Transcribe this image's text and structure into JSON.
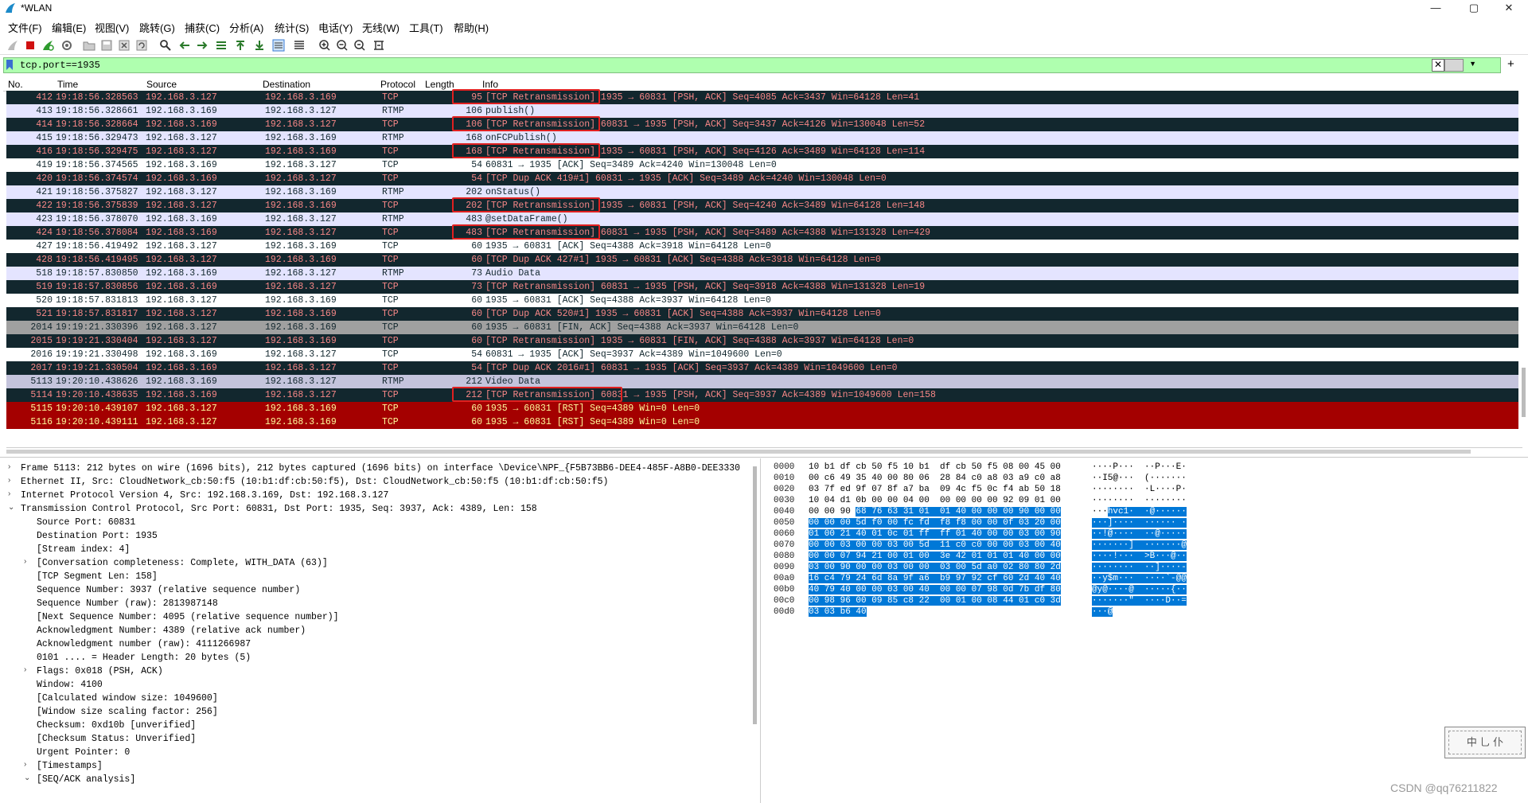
{
  "window": {
    "title": "*WLAN",
    "min": "—",
    "max": "▢",
    "close": "✕"
  },
  "menu": [
    "文件(F)",
    "编辑(E)",
    "视图(V)",
    "跳转(G)",
    "捕获(C)",
    "分析(A)",
    "统计(S)",
    "电话(Y)",
    "无线(W)",
    "工具(T)",
    "帮助(H)"
  ],
  "filter": {
    "value": "tcp.port==1935",
    "clear": "✕",
    "dropdown": "▼",
    "add": "+"
  },
  "columns": [
    "No.",
    "Time",
    "Source",
    "Destination",
    "Protocol",
    "Length",
    "Info"
  ],
  "packets": [
    {
      "no": "412",
      "time": "19:18:56.328563",
      "src": "192.168.3.127",
      "dst": "192.168.3.169",
      "proto": "TCP",
      "len": "95",
      "info": "[TCP Retransmission] 1935 → 60831 [PSH, ACK] Seq=4085 Ack=3437 Win=64128 Len=41",
      "style": "dark",
      "box": true
    },
    {
      "no": "413",
      "time": "19:18:56.328661",
      "src": "192.168.3.169",
      "dst": "192.168.3.127",
      "proto": "RTMP",
      "len": "106",
      "info": "publish()",
      "style": "light"
    },
    {
      "no": "414",
      "time": "19:18:56.328664",
      "src": "192.168.3.169",
      "dst": "192.168.3.127",
      "proto": "TCP",
      "len": "106",
      "info": "[TCP Retransmission] 60831 → 1935 [PSH, ACK] Seq=3437 Ack=4126 Win=130048 Len=52",
      "style": "dark",
      "box": true
    },
    {
      "no": "415",
      "time": "19:18:56.329473",
      "src": "192.168.3.127",
      "dst": "192.168.3.169",
      "proto": "RTMP",
      "len": "168",
      "info": "onFCPublish()",
      "style": "light"
    },
    {
      "no": "416",
      "time": "19:18:56.329475",
      "src": "192.168.3.127",
      "dst": "192.168.3.169",
      "proto": "TCP",
      "len": "168",
      "info": "[TCP Retransmission] 1935 → 60831 [PSH, ACK] Seq=4126 Ack=3489 Win=64128 Len=114",
      "style": "dark",
      "box": true
    },
    {
      "no": "419",
      "time": "19:18:56.374565",
      "src": "192.168.3.169",
      "dst": "192.168.3.127",
      "proto": "TCP",
      "len": "54",
      "info": "60831 → 1935 [ACK] Seq=3489 Ack=4240 Win=130048 Len=0",
      "style": "white"
    },
    {
      "no": "420",
      "time": "19:18:56.374574",
      "src": "192.168.3.169",
      "dst": "192.168.3.127",
      "proto": "TCP",
      "len": "54",
      "info": "[TCP Dup ACK 419#1] 60831 → 1935 [ACK] Seq=3489 Ack=4240 Win=130048 Len=0",
      "style": "dark"
    },
    {
      "no": "421",
      "time": "19:18:56.375827",
      "src": "192.168.3.127",
      "dst": "192.168.3.169",
      "proto": "RTMP",
      "len": "202",
      "info": "onStatus()",
      "style": "light"
    },
    {
      "no": "422",
      "time": "19:18:56.375839",
      "src": "192.168.3.127",
      "dst": "192.168.3.169",
      "proto": "TCP",
      "len": "202",
      "info": "[TCP Retransmission] 1935 → 60831 [PSH, ACK] Seq=4240 Ack=3489 Win=64128 Len=148",
      "style": "dark",
      "box": true
    },
    {
      "no": "423",
      "time": "19:18:56.378070",
      "src": "192.168.3.169",
      "dst": "192.168.3.127",
      "proto": "RTMP",
      "len": "483",
      "info": "@setDataFrame()",
      "style": "light"
    },
    {
      "no": "424",
      "time": "19:18:56.378084",
      "src": "192.168.3.169",
      "dst": "192.168.3.127",
      "proto": "TCP",
      "len": "483",
      "info": "[TCP Retransmission] 60831 → 1935 [PSH, ACK] Seq=3489 Ack=4388 Win=131328 Len=429",
      "style": "dark",
      "box": true
    },
    {
      "no": "427",
      "time": "19:18:56.419492",
      "src": "192.168.3.127",
      "dst": "192.168.3.169",
      "proto": "TCP",
      "len": "60",
      "info": "1935 → 60831 [ACK] Seq=4388 Ack=3918 Win=64128 Len=0",
      "style": "white"
    },
    {
      "no": "428",
      "time": "19:18:56.419495",
      "src": "192.168.3.127",
      "dst": "192.168.3.169",
      "proto": "TCP",
      "len": "60",
      "info": "[TCP Dup ACK 427#1] 1935 → 60831 [ACK] Seq=4388 Ack=3918 Win=64128 Len=0",
      "style": "dark"
    },
    {
      "no": "518",
      "time": "19:18:57.830850",
      "src": "192.168.3.169",
      "dst": "192.168.3.127",
      "proto": "RTMP",
      "len": "73",
      "info": "Audio Data",
      "style": "light"
    },
    {
      "no": "519",
      "time": "19:18:57.830856",
      "src": "192.168.3.169",
      "dst": "192.168.3.127",
      "proto": "TCP",
      "len": "73",
      "info": "[TCP Retransmission] 60831 → 1935 [PSH, ACK] Seq=3918 Ack=4388 Win=131328 Len=19",
      "style": "dark"
    },
    {
      "no": "520",
      "time": "19:18:57.831813",
      "src": "192.168.3.127",
      "dst": "192.168.3.169",
      "proto": "TCP",
      "len": "60",
      "info": "1935 → 60831 [ACK] Seq=4388 Ack=3937 Win=64128 Len=0",
      "style": "white"
    },
    {
      "no": "521",
      "time": "19:18:57.831817",
      "src": "192.168.3.127",
      "dst": "192.168.3.169",
      "proto": "TCP",
      "len": "60",
      "info": "[TCP Dup ACK 520#1] 1935 → 60831 [ACK] Seq=4388 Ack=3937 Win=64128 Len=0",
      "style": "dark"
    },
    {
      "no": "2014",
      "time": "19:19:21.330396",
      "src": "192.168.3.127",
      "dst": "192.168.3.169",
      "proto": "TCP",
      "len": "60",
      "info": "1935 → 60831 [FIN, ACK] Seq=4388 Ack=3937 Win=64128 Len=0",
      "style": "gray"
    },
    {
      "no": "2015",
      "time": "19:19:21.330404",
      "src": "192.168.3.127",
      "dst": "192.168.3.169",
      "proto": "TCP",
      "len": "60",
      "info": "[TCP Retransmission] 1935 → 60831 [FIN, ACK] Seq=4388 Ack=3937 Win=64128 Len=0",
      "style": "dark"
    },
    {
      "no": "2016",
      "time": "19:19:21.330498",
      "src": "192.168.3.169",
      "dst": "192.168.3.127",
      "proto": "TCP",
      "len": "54",
      "info": "60831 → 1935 [ACK] Seq=3937 Ack=4389 Win=1049600 Len=0",
      "style": "white"
    },
    {
      "no": "2017",
      "time": "19:19:21.330504",
      "src": "192.168.3.169",
      "dst": "192.168.3.127",
      "proto": "TCP",
      "len": "54",
      "info": "[TCP Dup ACK 2016#1] 60831 → 1935 [ACK] Seq=3937 Ack=4389 Win=1049600 Len=0",
      "style": "dark"
    },
    {
      "no": "5113",
      "time": "19:20:10.438626",
      "src": "192.168.3.169",
      "dst": "192.168.3.127",
      "proto": "RTMP",
      "len": "212",
      "info": "Video Data",
      "style": "lav"
    },
    {
      "no": "5114",
      "time": "19:20:10.438635",
      "src": "192.168.3.169",
      "dst": "192.168.3.127",
      "proto": "TCP",
      "len": "212",
      "info": "[TCP Retransmission] 60831 → 1935 [PSH, ACK] Seq=3937 Ack=4389 Win=1049600 Len=158",
      "style": "dark",
      "box": true
    },
    {
      "no": "5115",
      "time": "19:20:10.439107",
      "src": "192.168.3.127",
      "dst": "192.168.3.169",
      "proto": "TCP",
      "len": "60",
      "info": "1935 → 60831 [RST] Seq=4389 Win=0 Len=0",
      "style": "red"
    },
    {
      "no": "5116",
      "time": "19:20:10.439111",
      "src": "192.168.3.127",
      "dst": "192.168.3.169",
      "proto": "TCP",
      "len": "60",
      "info": "1935 → 60831 [RST] Seq=4389 Win=0 Len=0",
      "style": "red"
    }
  ],
  "details": [
    {
      "indent": 0,
      "arrow": "›",
      "text": "Frame 5113: 212 bytes on wire (1696 bits), 212 bytes captured (1696 bits) on interface \\Device\\NPF_{F5B73BB6-DEE4-485F-A8B0-DEE3330"
    },
    {
      "indent": 0,
      "arrow": "›",
      "text": "Ethernet II, Src: CloudNetwork_cb:50:f5 (10:b1:df:cb:50:f5), Dst: CloudNetwork_cb:50:f5 (10:b1:df:cb:50:f5)"
    },
    {
      "indent": 0,
      "arrow": "›",
      "text": "Internet Protocol Version 4, Src: 192.168.3.169, Dst: 192.168.3.127"
    },
    {
      "indent": 0,
      "arrow": "⌄",
      "text": "Transmission Control Protocol, Src Port: 60831, Dst Port: 1935, Seq: 3937, Ack: 4389, Len: 158"
    },
    {
      "indent": 1,
      "arrow": "",
      "text": "Source Port: 60831"
    },
    {
      "indent": 1,
      "arrow": "",
      "text": "Destination Port: 1935"
    },
    {
      "indent": 1,
      "arrow": "",
      "text": "[Stream index: 4]"
    },
    {
      "indent": 1,
      "arrow": "›",
      "text": "[Conversation completeness: Complete, WITH_DATA (63)]"
    },
    {
      "indent": 1,
      "arrow": "",
      "text": "[TCP Segment Len: 158]"
    },
    {
      "indent": 1,
      "arrow": "",
      "text": "Sequence Number: 3937    (relative sequence number)"
    },
    {
      "indent": 1,
      "arrow": "",
      "text": "Sequence Number (raw): 2813987148"
    },
    {
      "indent": 1,
      "arrow": "",
      "text": "[Next Sequence Number: 4095    (relative sequence number)]"
    },
    {
      "indent": 1,
      "arrow": "",
      "text": "Acknowledgment Number: 4389    (relative ack number)"
    },
    {
      "indent": 1,
      "arrow": "",
      "text": "Acknowledgment number (raw): 4111266987"
    },
    {
      "indent": 1,
      "arrow": "",
      "text": "0101 .... = Header Length: 20 bytes (5)"
    },
    {
      "indent": 1,
      "arrow": "›",
      "text": "Flags: 0x018 (PSH, ACK)"
    },
    {
      "indent": 1,
      "arrow": "",
      "text": "Window: 4100"
    },
    {
      "indent": 1,
      "arrow": "",
      "text": "[Calculated window size: 1049600]"
    },
    {
      "indent": 1,
      "arrow": "",
      "text": "[Window size scaling factor: 256]"
    },
    {
      "indent": 1,
      "arrow": "",
      "text": "Checksum: 0xd10b [unverified]"
    },
    {
      "indent": 1,
      "arrow": "",
      "text": "[Checksum Status: Unverified]"
    },
    {
      "indent": 1,
      "arrow": "",
      "text": "Urgent Pointer: 0"
    },
    {
      "indent": 1,
      "arrow": "›",
      "text": "[Timestamps]"
    },
    {
      "indent": 1,
      "arrow": "⌄",
      "text": "[SEQ/ACK analysis]"
    }
  ],
  "bytes": [
    {
      "off": "0000",
      "hex": "10 b1 df cb 50 f5 10 b1  df cb 50 f5 08 00 45 00",
      "hl": 0,
      "asc": "····P···  ··P···E·",
      "ahl": 0
    },
    {
      "off": "0010",
      "hex": "00 c6 49 35 40 00 80 06  28 84 c0 a8 03 a9 c0 a8",
      "hl": 0,
      "asc": "··I5@···  (·······",
      "ahl": 0
    },
    {
      "off": "0020",
      "hex": "03 7f ed 9f 07 8f a7 ba  09 4c f5 0c f4 ab 50 18",
      "hl": 0,
      "asc": "········  ·L····P·",
      "ahl": 0
    },
    {
      "off": "0030",
      "hex": "10 04 d1 0b 00 00 04 00  00 00 00 00 92 09 01 00",
      "hl": 0,
      "asc": "········  ········",
      "ahl": 0
    },
    {
      "off": "0040",
      "hex": "00 00 90 68 76 63 31 01  01 40 00 00 00 90 00 00",
      "hl": 9,
      "asc": "···hvc1·  ·@······",
      "ahl": 3
    },
    {
      "off": "0050",
      "hex": "00 00 00 5d f0 00 fc fd  f8 f8 00 00 0f 03 20 00",
      "hl": -1,
      "asc": "···]····  ······ ·",
      "ahl": -1
    },
    {
      "off": "0060",
      "hex": "01 00 21 40 01 0c 01 ff  ff 01 40 00 00 03 00 90",
      "hl": -1,
      "asc": "··!@····  ··@·····",
      "ahl": -1
    },
    {
      "off": "0070",
      "hex": "00 00 03 00 00 03 00 5d  11 c0 c0 00 00 03 00 40",
      "hl": -1,
      "asc": "·······]  ·······@",
      "ahl": -1
    },
    {
      "off": "0080",
      "hex": "00 00 07 94 21 00 01 00  3e 42 01 01 01 40 00 00",
      "hl": -1,
      "asc": "····!···  >B···@··",
      "ahl": -1
    },
    {
      "off": "0090",
      "hex": "03 00 90 00 00 03 00 00  03 00 5d a0 02 80 80 2d",
      "hl": -1,
      "asc": "········  ··]····-",
      "ahl": -1
    },
    {
      "off": "00a0",
      "hex": "16 c4 79 24 6d 8a 9f a6  b9 97 92 cf 60 2d 40 40",
      "hl": -1,
      "asc": "··y$m···  ····`-@@",
      "ahl": -1
    },
    {
      "off": "00b0",
      "hex": "40 79 40 00 00 03 00 40  00 00 07 98 0d 7b df 80",
      "hl": -1,
      "asc": "@y@····@  ·····{··",
      "ahl": -1
    },
    {
      "off": "00c0",
      "hex": "00 98 96 00 09 85 c8 22  00 01 00 08 44 01 c0 3d",
      "hl": -1,
      "asc": "·······\"  ····D··=",
      "ahl": -1
    },
    {
      "off": "00d0",
      "hex": "03 03 b6 40",
      "hl": -1,
      "asc": "···@",
      "ahl": -1
    }
  ],
  "stamp": "中 ⺃ 仆",
  "watermark": "CSDN @qq76211822",
  "colors": {
    "filter_bg": "#afffaf",
    "dark_row_bg": "#12272e",
    "dark_row_fg": "#f78787",
    "rst_bg": "#a40000",
    "rst_fg": "#fffc9c",
    "highlight": "#0078d7",
    "annotation": "#e02020"
  }
}
